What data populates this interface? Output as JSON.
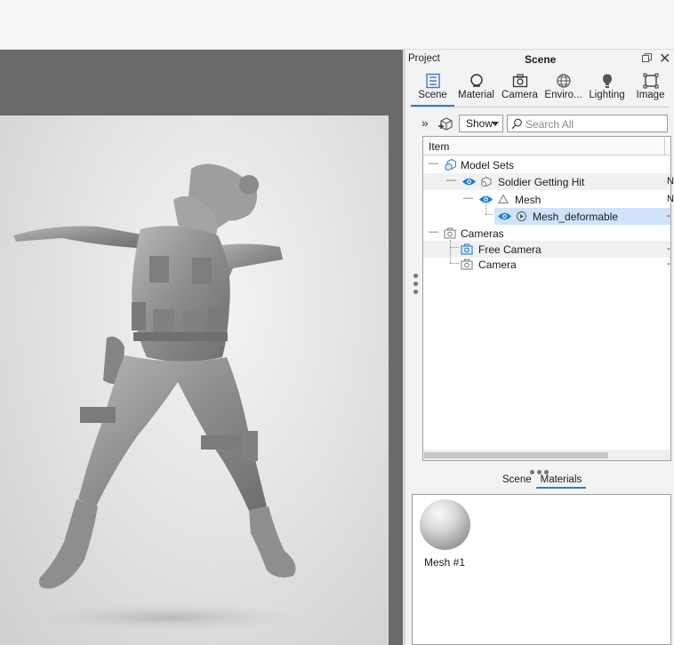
{
  "panel": {
    "project_label": "Project",
    "title": "Scene"
  },
  "tabs": [
    {
      "label": "Scene",
      "icon": "scene-list-icon",
      "active": true
    },
    {
      "label": "Material",
      "icon": "material-ball-icon",
      "active": false
    },
    {
      "label": "Camera",
      "icon": "camera-icon",
      "active": false
    },
    {
      "label": "Enviro...",
      "icon": "globe-icon",
      "active": false
    },
    {
      "label": "Lighting",
      "icon": "lightbulb-icon",
      "active": false
    },
    {
      "label": "Image",
      "icon": "image-frame-icon",
      "active": false
    }
  ],
  "toolbar": {
    "show_label": "Show",
    "search_placeholder": "Search All"
  },
  "tree": {
    "header": "Item",
    "rows": [
      {
        "label": "Model Sets",
        "extra": ""
      },
      {
        "label": "Soldier Getting Hit",
        "extra": "N"
      },
      {
        "label": "Mesh",
        "extra": "N"
      },
      {
        "label": "Mesh_deformable",
        "extra": "-",
        "selected": true
      },
      {
        "label": "Cameras",
        "extra": ""
      },
      {
        "label": "Free Camera",
        "extra": "-"
      },
      {
        "label": "Camera",
        "extra": "-"
      }
    ]
  },
  "subtabs": [
    {
      "label": "Scene",
      "active": false
    },
    {
      "label": "Materials",
      "active": true
    }
  ],
  "materials": [
    {
      "name": "Mesh #1"
    }
  ],
  "colors": {
    "accent": "#3a78c8",
    "selection": "#cfe4fb",
    "eye_icon": "#1e7bd4"
  }
}
